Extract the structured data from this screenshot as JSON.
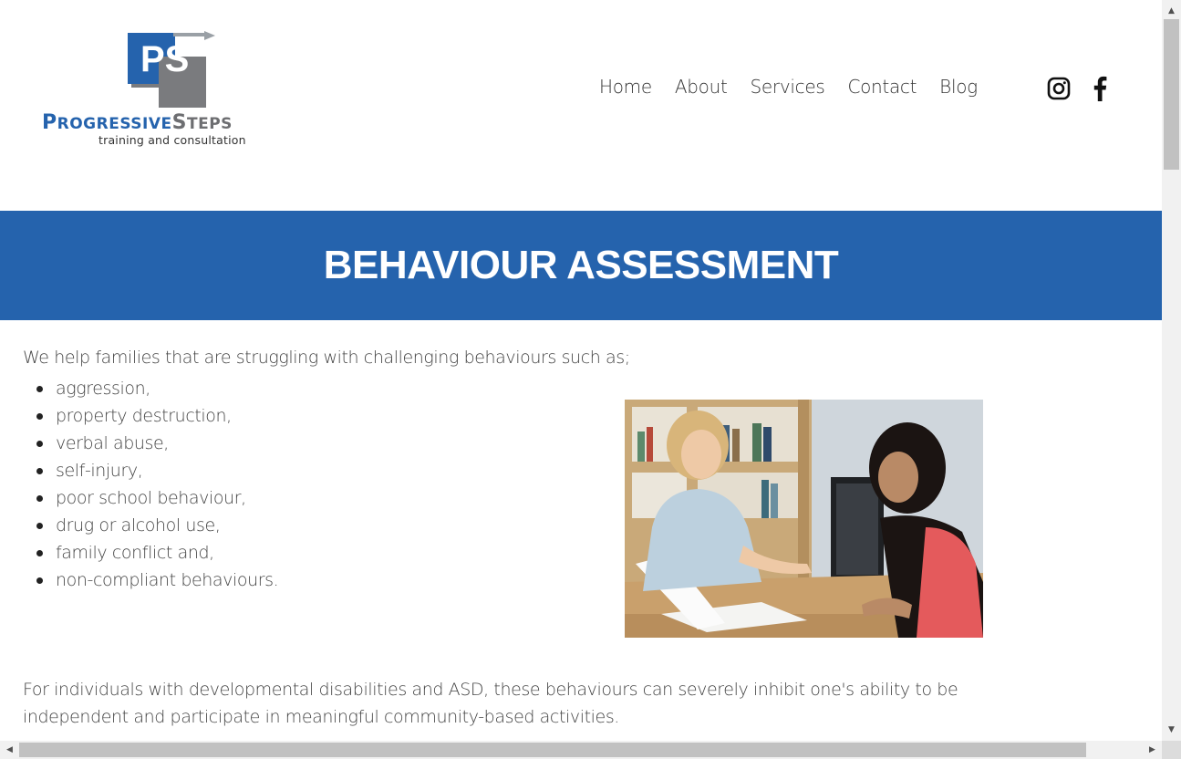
{
  "header": {
    "logo": {
      "monogram": "PS",
      "brand_big_1": "P",
      "brand_small_1": "ROGRESSIVE",
      "brand_big_2": "S",
      "brand_small_2": "TEPS",
      "tagline": "training and consultation"
    },
    "nav": [
      {
        "label": "Home"
      },
      {
        "label": "About"
      },
      {
        "label": "Services"
      },
      {
        "label": "Contact"
      },
      {
        "label": "Blog"
      }
    ],
    "social": [
      {
        "icon": "instagram-icon"
      },
      {
        "icon": "facebook-icon"
      }
    ]
  },
  "banner": {
    "title": "BEHAVIOUR ASSESSMENT"
  },
  "content": {
    "intro": "We help families that are struggling with challenging behaviours such as;",
    "behaviours": [
      "aggression,",
      "property destruction,",
      "verbal abuse,",
      "self-injury,",
      "poor school behaviour,",
      "drug or alcohol use,",
      "family conflict and,",
      "non-compliant behaviours."
    ],
    "paragraph": "For individuals with developmental disabilities and ASD, these behaviours can severely inhibit one's ability to be independent and participate in meaningful community-based activities."
  },
  "colors": {
    "brand_blue": "#2563ad",
    "brand_gray": "#6d6e71",
    "text": "#444444"
  }
}
